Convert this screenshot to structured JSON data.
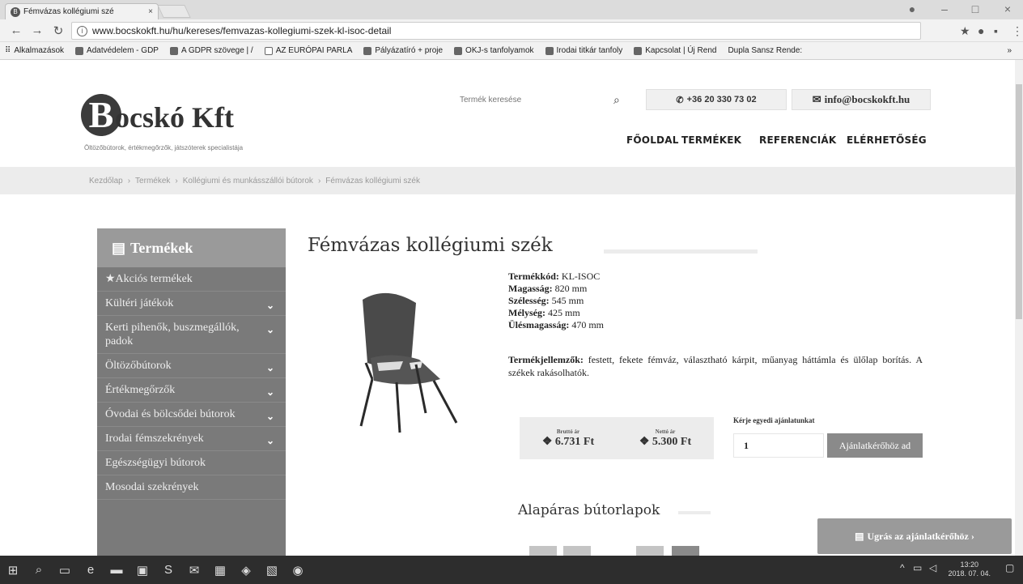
{
  "browser": {
    "tab_title": "Fémvázas kollégiumi szé",
    "tab_close": "×",
    "url": "www.bocskokft.hu/hu/kereses/femvazas-kollegiumi-szek-kl-isoc-detail",
    "bookmarks": [
      "Alkalmazások",
      "Adatvédelem - GDP",
      "A GDPR szövege | /",
      "AZ EURÓPAI PARLA",
      "Pályázatíró + proje",
      "OKJ-s tanfolyamok",
      "Irodai titkár tanfoly",
      "Kapcsolat | Új Rend",
      "Dupla Sansz Rende:"
    ],
    "more_bookmarks": "»"
  },
  "header": {
    "logo_letter": "B",
    "logo_name": "ocskó Kft",
    "logo_tagline": "Öltözőbútorok, értékmegőrzők, játszóterek specialistája",
    "search_placeholder": "Termék keresése",
    "phone": "+36 20 330 73 02",
    "email": "info@bocskokft.hu",
    "nav": [
      "FŐOLDAL",
      "TERMÉKEK",
      "REFERENCIÁK",
      "ELÉRHETŐSÉG"
    ]
  },
  "breadcrumb": [
    "Kezdőlap",
    "Termékek",
    "Kollégiumi és munkásszállói bútorok",
    "Fémvázas kollégiumi szék"
  ],
  "sidebar": {
    "title": "Termékek",
    "items": [
      {
        "label": "★Akciós termékek",
        "chevron": false
      },
      {
        "label": "Kültéri játékok",
        "chevron": true
      },
      {
        "label": "Kerti pihenők, buszmegállók, padok",
        "chevron": true
      },
      {
        "label": "Öltözőbútorok",
        "chevron": true
      },
      {
        "label": "Értékmegőrzők",
        "chevron": true
      },
      {
        "label": "Óvodai és bölcsődei bútorok",
        "chevron": true
      },
      {
        "label": "Irodai fémszekrények",
        "chevron": true
      },
      {
        "label": "Egészségügyi bútorok",
        "chevron": false
      },
      {
        "label": "Mosodai szekrények",
        "chevron": false
      }
    ]
  },
  "product": {
    "title": "Fémvázas kollégiumi szék",
    "specs": [
      {
        "label": "Termékkód:",
        "value": "KL-ISOC"
      },
      {
        "label": "Magasság:",
        "value": "820 mm"
      },
      {
        "label": "Szélesség:",
        "value": "545 mm"
      },
      {
        "label": "Mélység:",
        "value": "425 mm"
      },
      {
        "label": "Ülésmagasság:",
        "value": "470 mm"
      }
    ],
    "description_label": "Termékjellemzők:",
    "description": "festett, fekete fémváz, választható kárpit, műanyag háttámla és ülőlap borítás. A székek rakásolhatók.",
    "gross_label": "Bruttó ár",
    "gross_price": "6.731 Ft",
    "net_label": "Nettó ár",
    "net_price": "5.300 Ft",
    "offer_label": "Kérje egyedi ajánlatunkat",
    "quantity": "1",
    "offer_button": "Ajánlatkérőhöz ad",
    "section_title": "Alapáras bútorlapok",
    "jump_button": "Ugrás az ajánlatkérőhöz ›"
  },
  "taskbar": {
    "time": "13:20",
    "date": "2018. 07. 04."
  }
}
